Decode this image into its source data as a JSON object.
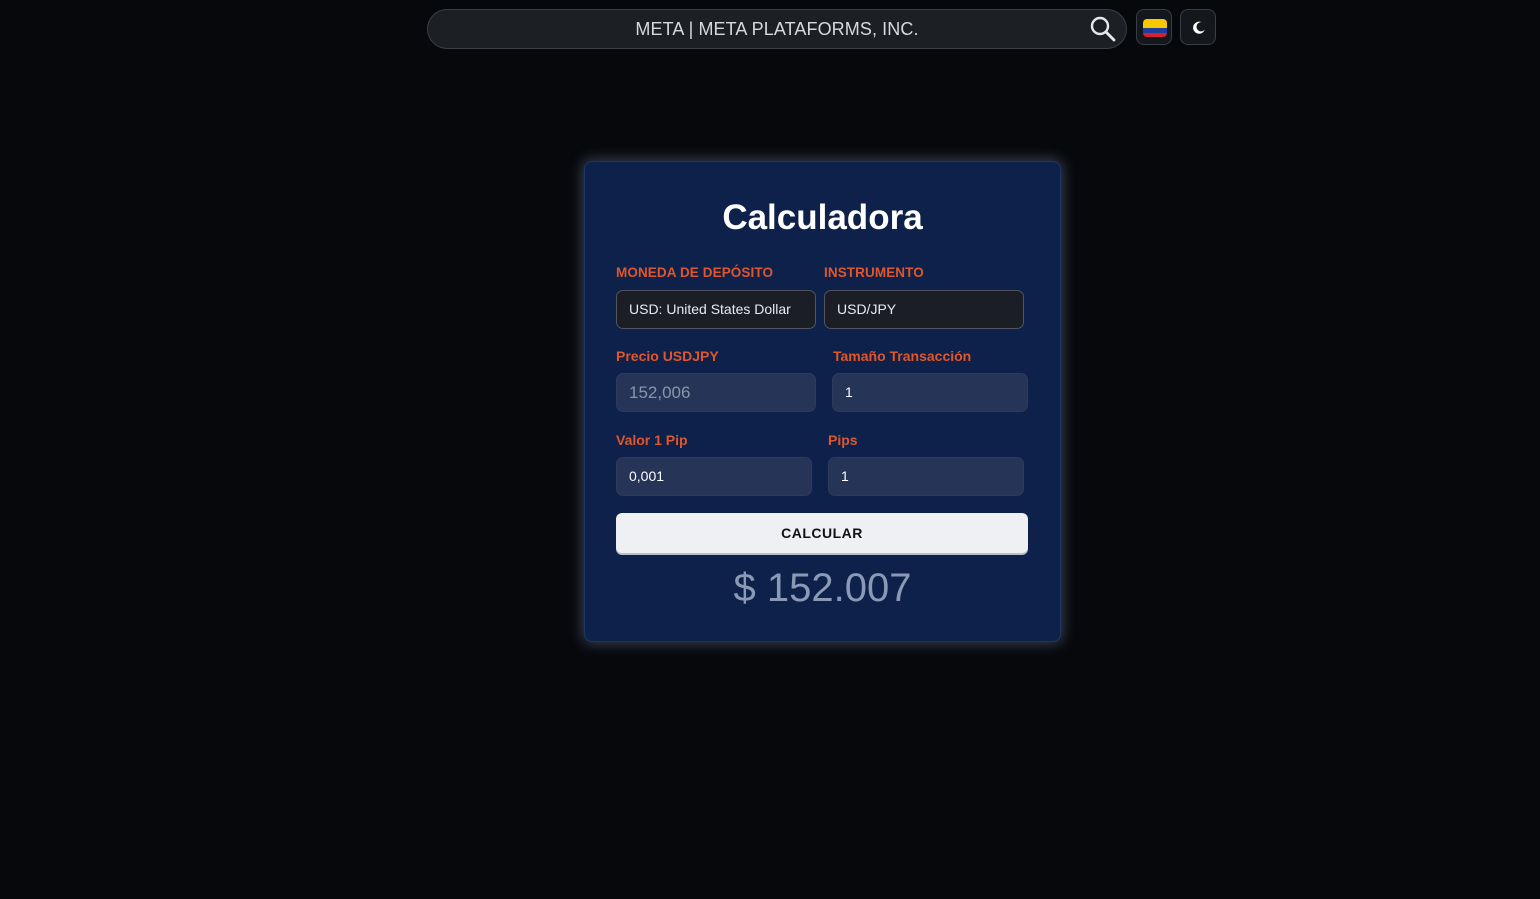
{
  "header": {
    "search_text": "META  |  META PLATAFORMS, INC.",
    "search_icon": "search-icon",
    "flag_icon": "colombia-flag-icon",
    "theme_icon": "moon-icon"
  },
  "calculator": {
    "title": "Calculadora",
    "deposit_currency_label": "MONEDA DE DEPÓSITO",
    "deposit_currency_value": "USD: United States Dollar",
    "instrument_label": "INSTRUMENTO",
    "instrument_value": "USD/JPY",
    "price_label": "Precio USDJPY",
    "price_placeholder": "152,006",
    "size_label": "Tamaño Transacción",
    "size_value": "1",
    "pip_value_label": "Valor 1 Pip",
    "pip_value_value": "0,001",
    "pips_label": "Pips",
    "pips_value": "1",
    "button_label": "CALCULAR",
    "result": "$ 152.007"
  },
  "colors": {
    "background": "#06080c",
    "card": "#0e214a",
    "accent_label": "#e0562b",
    "button_bg": "#eef0f4",
    "result_text": "#8a9ab6"
  }
}
